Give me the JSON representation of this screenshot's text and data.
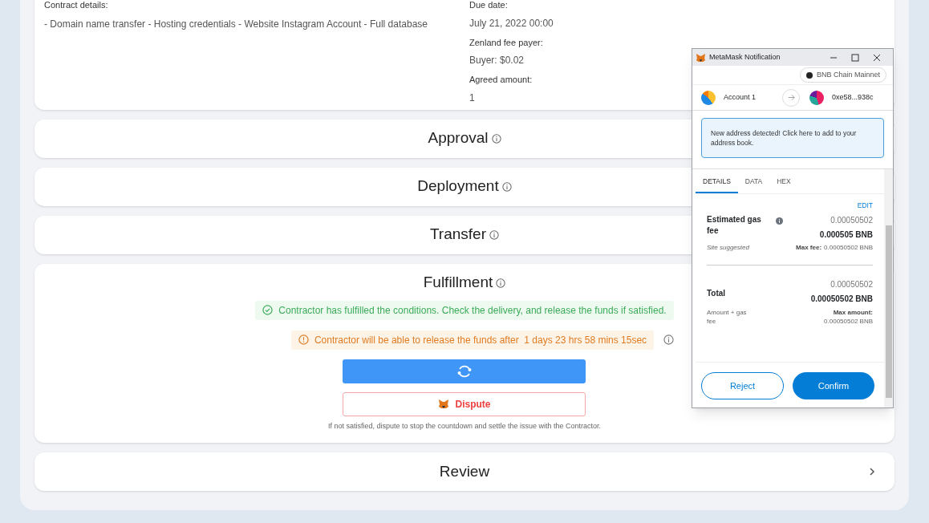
{
  "contract": {
    "details": {
      "label": "Contract details:",
      "value": "- Domain name transfer - Hosting credentials - Website Instagram Account - Full database"
    },
    "side_fields": [
      {
        "label": "Due date:",
        "value": "July 21, 2022 00:00"
      },
      {
        "label": "Zenland fee payer:",
        "value": "Buyer: $0.02"
      },
      {
        "label": "Agreed amount:",
        "value": "1"
      }
    ]
  },
  "steps": [
    {
      "title": "Approval",
      "kind": "collapsed"
    },
    {
      "title": "Deployment",
      "kind": "collapsed"
    },
    {
      "title": "Transfer",
      "kind": "collapsed"
    },
    {
      "title": "Fulfillment",
      "kind": "expanded",
      "success": "Contractor has fulfilled the conditions. Check the delivery, and release the funds if satisfied.",
      "warning": "Contractor will be able to release the funds after  1 days 23 hrs 58 mins 15sec",
      "release_loading": true,
      "dispute": "Dispute",
      "hint": "If not satisfied, dispute to stop the countdown and settle the issue with the Contractor."
    },
    {
      "title": "Review",
      "kind": "link"
    }
  ],
  "metamask": {
    "title": "MetaMask Notification",
    "network": "BNB Chain Mainnet",
    "from": "Account 1",
    "to": "0xe58...938c",
    "notice": "New address detected! Click here to add to your address book.",
    "tabs": [
      {
        "label": "DETAILS",
        "selected": true
      },
      {
        "label": "DATA",
        "selected": false
      },
      {
        "label": "HEX",
        "selected": false
      }
    ],
    "edit": "EDIT",
    "gas": {
      "label": "Estimated gas fee",
      "amount": "0.00050502",
      "amount_bold": "0.000505 BNB",
      "note": "Site suggested",
      "max_label": "Max fee:",
      "max_value": "0.00050502 BNB"
    },
    "total": {
      "label": "Total",
      "amount": "0.00050502",
      "amount_bold": "0.00050502 BNB",
      "note": "Amount + gas fee",
      "max_label": "Max amount:",
      "max_value": "0.00050502 BNB"
    },
    "buttons": [
      "Reject",
      "Confirm"
    ]
  }
}
